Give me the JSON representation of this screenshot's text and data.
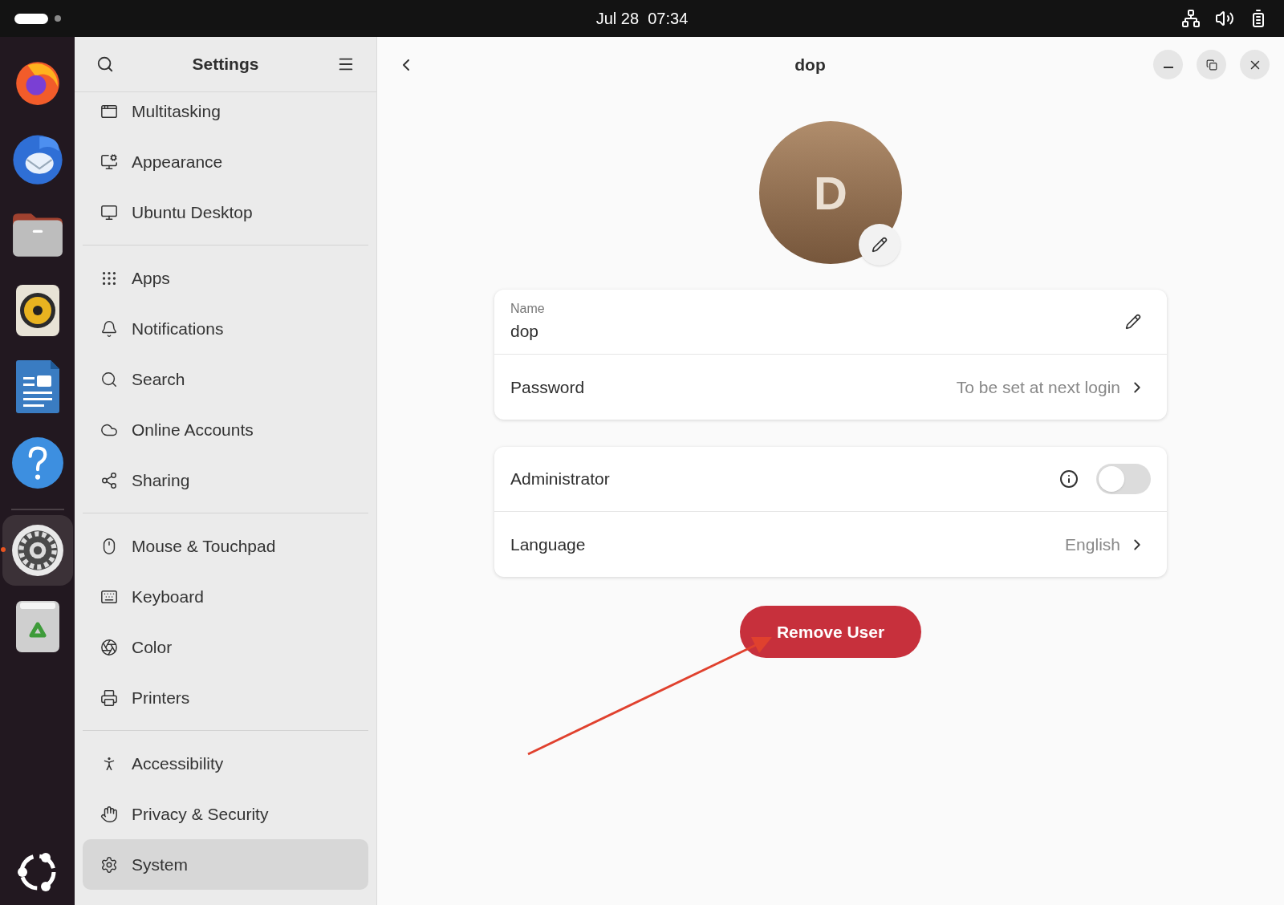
{
  "top_bar": {
    "clock": "Jul 28  07:34"
  },
  "dock": {
    "apps": [
      {
        "kind": "firefox",
        "active": false
      },
      {
        "kind": "thunderbird",
        "active": false
      },
      {
        "kind": "files",
        "active": false
      },
      {
        "kind": "rhythmbox",
        "active": false
      },
      {
        "kind": "writer",
        "active": false
      },
      {
        "kind": "help",
        "active": false
      },
      {
        "kind": "settings",
        "active": true
      },
      {
        "kind": "trash",
        "active": false
      }
    ]
  },
  "sidebar": {
    "title": "Settings",
    "groups": [
      {
        "items": [
          {
            "kind": "multitasking",
            "label": "Multitasking",
            "selected": false
          },
          {
            "kind": "appearance",
            "label": "Appearance",
            "selected": false
          },
          {
            "kind": "desktop",
            "label": "Ubuntu Desktop",
            "selected": false
          }
        ]
      },
      {
        "items": [
          {
            "kind": "apps",
            "label": "Apps",
            "selected": false
          },
          {
            "kind": "notifications",
            "label": "Notifications",
            "selected": false
          },
          {
            "kind": "search",
            "label": "Search",
            "selected": false
          },
          {
            "kind": "online",
            "label": "Online Accounts",
            "selected": false
          },
          {
            "kind": "sharing",
            "label": "Sharing",
            "selected": false
          }
        ]
      },
      {
        "items": [
          {
            "kind": "mouse",
            "label": "Mouse & Touchpad",
            "selected": false
          },
          {
            "kind": "keyboard",
            "label": "Keyboard",
            "selected": false
          },
          {
            "kind": "color",
            "label": "Color",
            "selected": false
          },
          {
            "kind": "printers",
            "label": "Printers",
            "selected": false
          }
        ]
      },
      {
        "items": [
          {
            "kind": "accessibility",
            "label": "Accessibility",
            "selected": false
          },
          {
            "kind": "privacy",
            "label": "Privacy & Security",
            "selected": false
          },
          {
            "kind": "system",
            "label": "System",
            "selected": true
          }
        ]
      }
    ]
  },
  "page": {
    "title": "dop",
    "avatar": {
      "initial": "D"
    },
    "account_card": {
      "name_label": "Name",
      "name_value": "dop",
      "password_label": "Password",
      "password_value": "To be set at next login"
    },
    "settings_card": {
      "administrator_label": "Administrator",
      "administrator_on": false,
      "language_label": "Language",
      "language_value": "English"
    },
    "remove_button": "Remove User"
  }
}
